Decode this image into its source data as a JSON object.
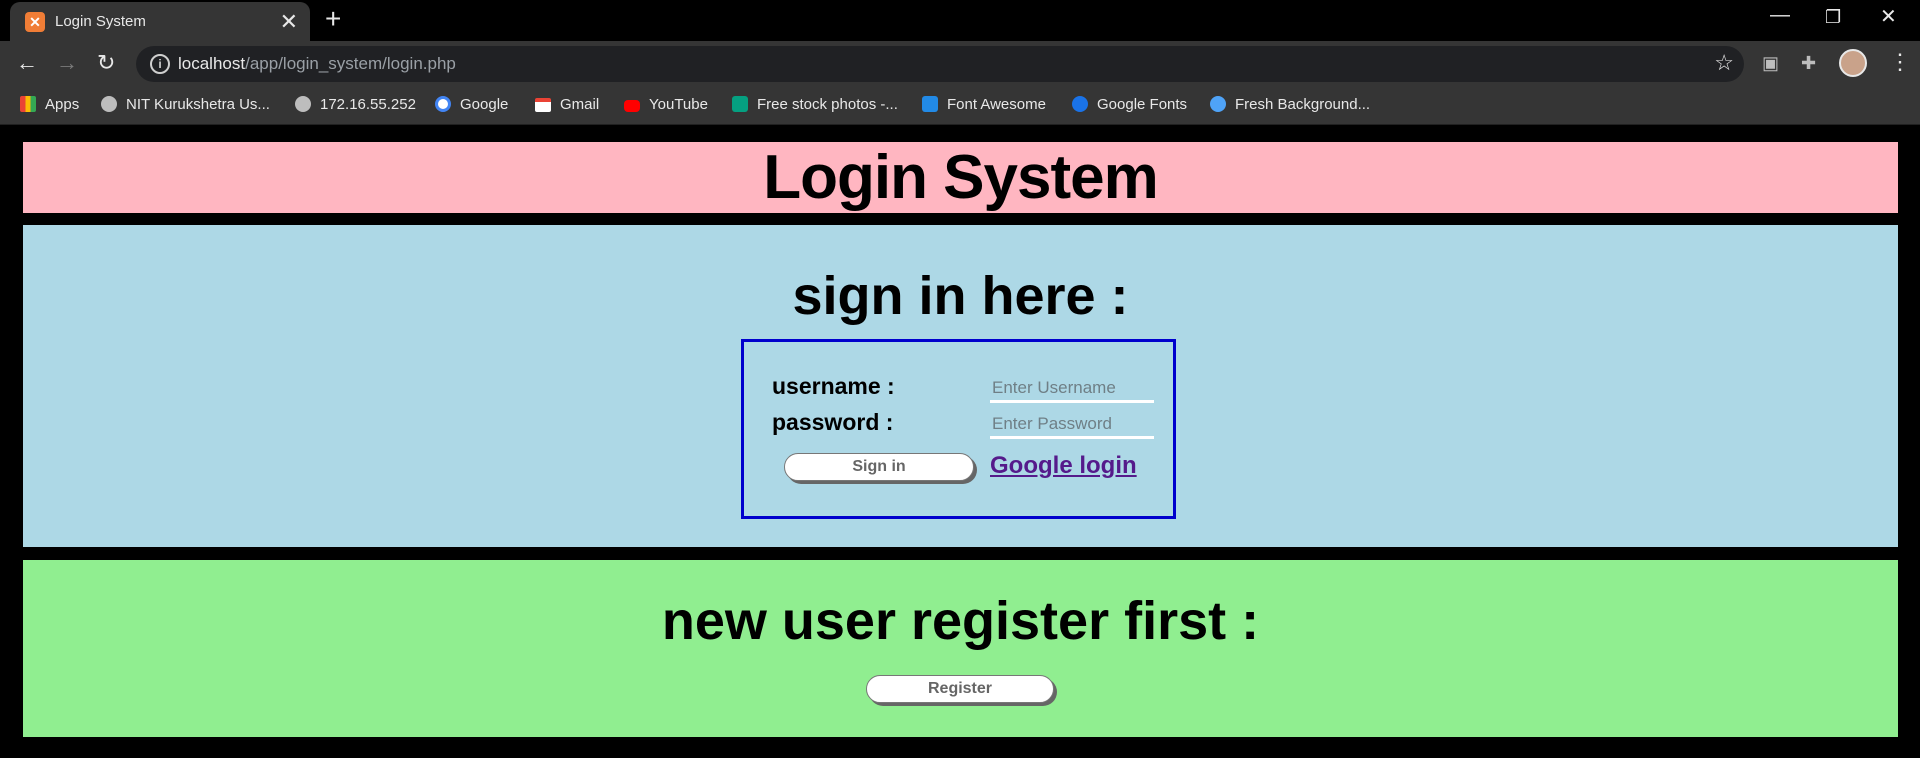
{
  "browser": {
    "tab_title": "Login System",
    "tab_favicon": "xampp-icon",
    "url_host": "localhost",
    "url_path": "/app/login_system/login.php",
    "bookmarks": [
      {
        "label": "Apps",
        "icon": "apps-grid-icon",
        "color": "#ea4335"
      },
      {
        "label": "NIT Kurukshetra Us...",
        "icon": "globe-icon",
        "color": "#bdbdbd"
      },
      {
        "label": "172.16.55.252",
        "icon": "globe-icon",
        "color": "#bdbdbd"
      },
      {
        "label": "Google",
        "icon": "google-icon",
        "color": "#4285f4"
      },
      {
        "label": "Gmail",
        "icon": "gmail-icon",
        "color": "#ea4335"
      },
      {
        "label": "YouTube",
        "icon": "youtube-icon",
        "color": "#ff0000"
      },
      {
        "label": "Free stock photos -...",
        "icon": "pexels-icon",
        "color": "#05a081"
      },
      {
        "label": "Font Awesome",
        "icon": "flag-icon",
        "color": "#228ae6"
      },
      {
        "label": "Google Fonts",
        "icon": "google-fonts-icon",
        "color": "#1a73e8"
      },
      {
        "label": "Fresh Background...",
        "icon": "background-icon",
        "color": "#4fa3f7"
      }
    ]
  },
  "page": {
    "header_title": "Login System",
    "header_bg": "#ffb6c1",
    "signin": {
      "heading": "sign in here :",
      "bg": "#add8e6",
      "username_label": "username :",
      "username_placeholder": "Enter Username",
      "password_label": "password :",
      "password_placeholder": "Enter Password",
      "signin_button": "Sign in",
      "google_link": "Google login"
    },
    "register": {
      "heading": "new user register first :",
      "bg": "#90ee90",
      "register_button": "Register"
    }
  }
}
